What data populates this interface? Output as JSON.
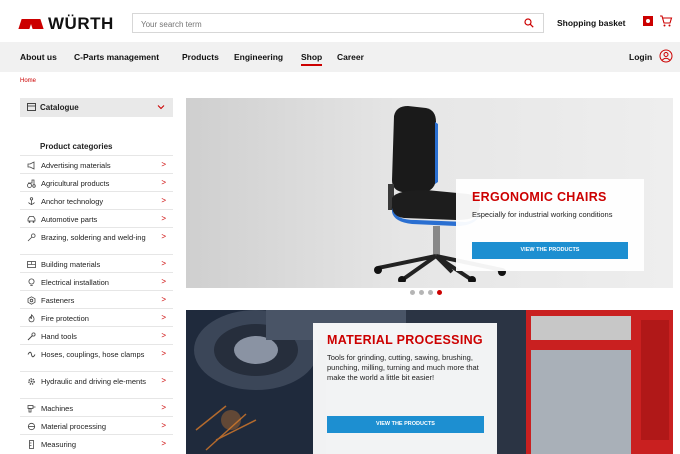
{
  "header": {
    "logo_text": "WÜRTH",
    "search_placeholder": "Your search term",
    "basket_label": "Shopping basket"
  },
  "nav": {
    "items": [
      "About us",
      "C-Parts management",
      "Products",
      "Engineering",
      "Shop",
      "Career"
    ],
    "active": "Shop",
    "login_label": "Login"
  },
  "breadcrumb": "Home",
  "sidebar": {
    "catalogue_label": "Catalogue",
    "categories_title": "Product categories",
    "categories": [
      {
        "label": "Advertising materials",
        "icon": "megaphone-icon"
      },
      {
        "label": "Agricultural products",
        "icon": "tractor-icon"
      },
      {
        "label": "Anchor technology",
        "icon": "anchor-icon"
      },
      {
        "label": "Automotive parts",
        "icon": "car-icon"
      },
      {
        "label": "Brazing, soldering and weld-ing",
        "icon": "soldering-icon"
      },
      {
        "label": "Building materials",
        "icon": "bricks-icon"
      },
      {
        "label": "Electrical installation",
        "icon": "bulb-icon"
      },
      {
        "label": "Fasteners",
        "icon": "nut-icon"
      },
      {
        "label": "Fire protection",
        "icon": "flame-icon"
      },
      {
        "label": "Hand tools",
        "icon": "wrench-icon"
      },
      {
        "label": "Hoses, couplings, hose clamps",
        "icon": "hose-icon"
      },
      {
        "label": "Hydraulic and driving ele-ments",
        "icon": "gear-icon"
      },
      {
        "label": "Machines",
        "icon": "drill-icon"
      },
      {
        "label": "Material processing",
        "icon": "grinder-icon"
      },
      {
        "label": "Measuring",
        "icon": "ruler-icon"
      }
    ]
  },
  "banners": {
    "chairs": {
      "title": "ERGONOMIC CHAIRS",
      "text": "Especially for industrial working conditions",
      "button": "VIEW THE PRODUCTS"
    },
    "processing": {
      "title": "MATERIAL PROCESSING",
      "text": "Tools for grinding, cutting, sawing, brushing, punching, milling, turning and much more that make the world a little bit easier!",
      "button": "VIEW THE PRODUCTS"
    },
    "carousel_dots": 4,
    "carousel_active": 4
  },
  "colors": {
    "brand_red": "#cc0000",
    "button_blue": "#1d8fd1",
    "nav_bg": "#f1f1f1"
  }
}
